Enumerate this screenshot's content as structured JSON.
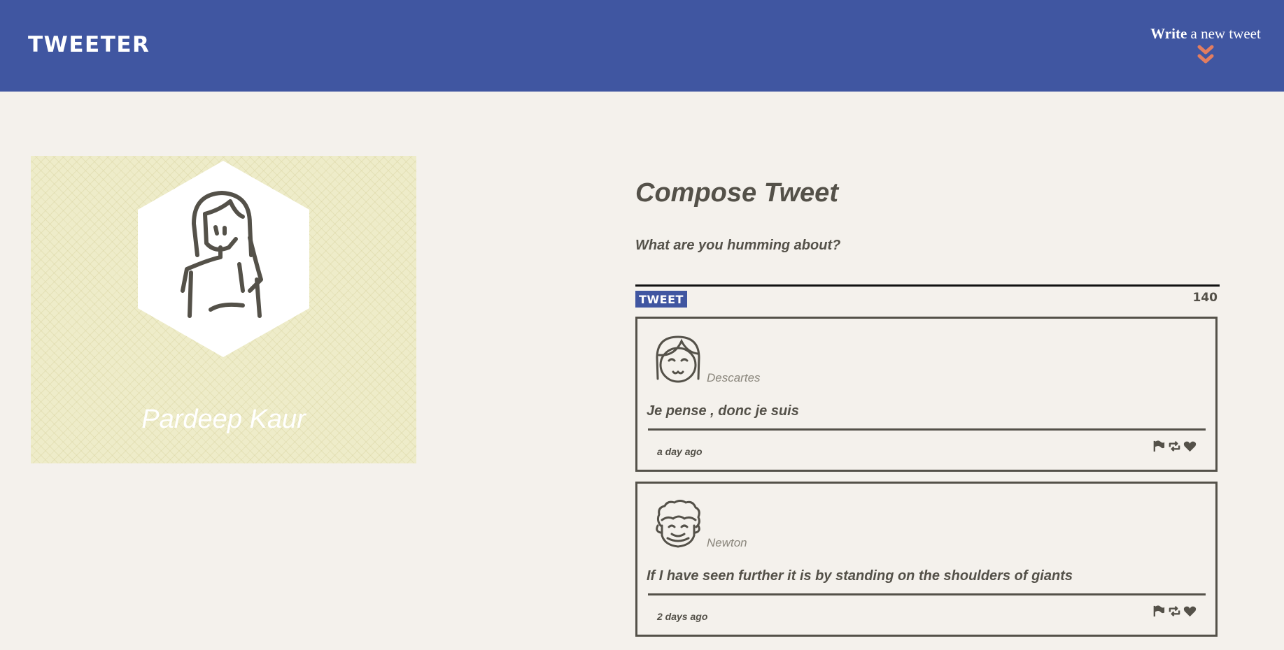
{
  "nav": {
    "brand": "TWEETER",
    "write_strong": "Write",
    "write_rest": " a new tweet",
    "chevron_icon": "chevron-double-down-icon",
    "accent_color": "#e27d60"
  },
  "profile": {
    "name": "Pardeep Kaur",
    "avatar_icon": "woman-avatar-icon"
  },
  "compose": {
    "title": "Compose Tweet",
    "placeholder": "What are you humming about?",
    "button_label": "TWEET",
    "counter": "140"
  },
  "tweets": [
    {
      "author": "Descartes",
      "avatar_icon": "girl-face-avatar-icon",
      "content": "Je pense , donc je suis",
      "time": "a day ago",
      "actions": [
        "flag-icon",
        "retweet-icon",
        "heart-icon"
      ]
    },
    {
      "author": "Newton",
      "avatar_icon": "curly-hair-face-avatar-icon",
      "content": "If I have seen further it is by standing on the shoulders of giants",
      "time": "2 days ago",
      "actions": [
        "flag-icon",
        "retweet-icon",
        "heart-icon"
      ]
    }
  ],
  "colors": {
    "nav_bg": "#4056a1",
    "page_bg": "#f4f1ec",
    "profile_bg": "#eeecc9",
    "text": "#545149"
  }
}
